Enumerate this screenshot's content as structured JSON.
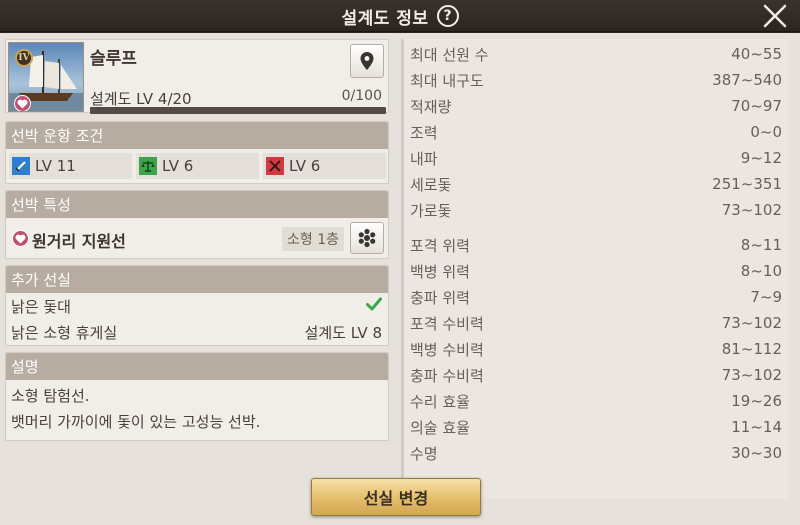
{
  "window": {
    "title": "설계도 정보",
    "help_icon": "?"
  },
  "ship": {
    "name": "슬루프",
    "tier_badge": "IV",
    "blueprint_label": "설계도 LV 4/20",
    "blueprint_value": "0/100",
    "blueprint_progress": 0
  },
  "conditions": {
    "header": "선박 운항 조건",
    "items": [
      {
        "icon": "sword-icon",
        "label": "LV 11",
        "color": "#2f7fcf"
      },
      {
        "icon": "trade-scale-icon",
        "label": "LV 6",
        "color": "#3aa54a"
      },
      {
        "icon": "crossed-swords-icon",
        "label": "LV 6",
        "color": "#d0393f"
      }
    ]
  },
  "traits": {
    "header": "선박 특성",
    "name": "원거리 지원선",
    "size": "소형 1층"
  },
  "cabins": {
    "header": "추가 선실",
    "rows": [
      {
        "label": "낡은 돛대",
        "value": "✔"
      },
      {
        "label": "낡은 소형 휴게실",
        "value": "설계도 LV 8"
      }
    ]
  },
  "description": {
    "header": "설명",
    "lines": [
      "소형 탐험선.",
      "뱃머리 가까이에 돛이 있는 고성능 선박."
    ]
  },
  "stats": {
    "group1": [
      {
        "label": "최대 선원 수",
        "value": "40~55"
      },
      {
        "label": "최대 내구도",
        "value": "387~540"
      },
      {
        "label": "적재량",
        "value": "70~97"
      },
      {
        "label": "조력",
        "value": "0~0"
      },
      {
        "label": "내파",
        "value": "9~12"
      },
      {
        "label": "세로돛",
        "value": "251~351"
      },
      {
        "label": "가로돛",
        "value": "73~102"
      }
    ],
    "group2": [
      {
        "label": "포격 위력",
        "value": "8~11"
      },
      {
        "label": "백병 위력",
        "value": "8~10"
      },
      {
        "label": "충파 위력",
        "value": "7~9"
      },
      {
        "label": "포격 수비력",
        "value": "73~102"
      },
      {
        "label": "백병 수비력",
        "value": "81~112"
      },
      {
        "label": "충파 수비력",
        "value": "73~102"
      },
      {
        "label": "수리 효율",
        "value": "19~26"
      },
      {
        "label": "의술 효율",
        "value": "11~14"
      },
      {
        "label": "수명",
        "value": "30~30"
      }
    ]
  },
  "actions": {
    "change_cabin": "선실 변경"
  }
}
